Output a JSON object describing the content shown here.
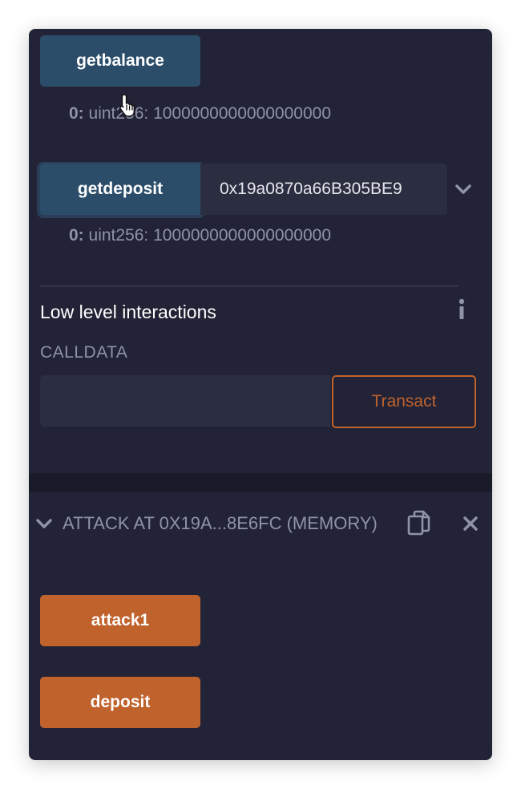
{
  "functions": {
    "getbalance": {
      "label": "getbalance",
      "result_index": "0:",
      "result_value": "uint256: 1000000000000000000"
    },
    "getdeposit": {
      "label": "getdeposit",
      "input_value": "0x19a0870a66B305BE9",
      "result_index": "0:",
      "result_value": "uint256: 1000000000000000000"
    }
  },
  "low_level": {
    "title": "Low level interactions",
    "calldata_label": "CALLDATA",
    "calldata_value": "",
    "transact_label": "Transact"
  },
  "instance": {
    "title": "ATTACK AT 0X19A...8E6FC (MEMORY)",
    "buttons": {
      "attack1": "attack1",
      "deposit": "deposit"
    }
  },
  "icons": {
    "expand": "chevron-down-icon",
    "info": "info-icon",
    "copy": "copy-icon",
    "close": "close-icon",
    "cursor": "hand-pointer-icon"
  },
  "colors": {
    "panel_bg": "#222336",
    "call_button": "#2b4d69",
    "transact_button": "#c0622c",
    "muted_text": "#8f93a8"
  }
}
